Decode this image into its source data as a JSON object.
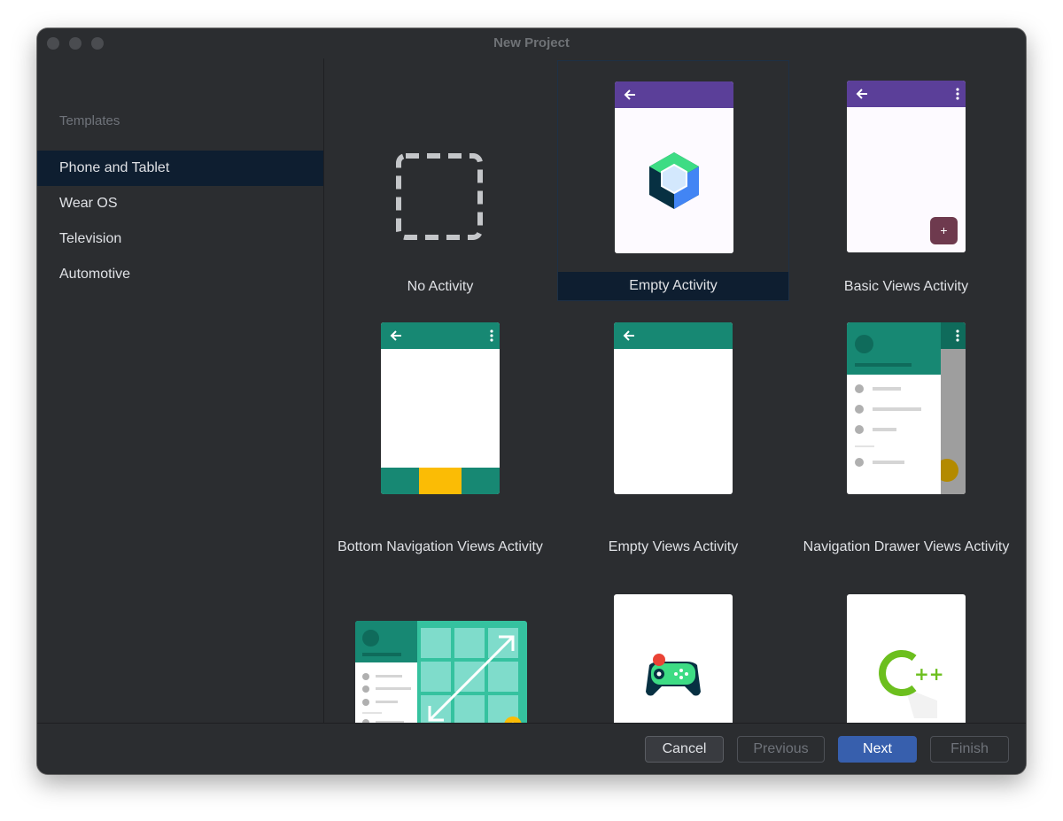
{
  "window": {
    "title": "New Project"
  },
  "sidebar": {
    "header": "Templates",
    "items": [
      {
        "label": "Phone and Tablet",
        "selected": true
      },
      {
        "label": "Wear OS",
        "selected": false
      },
      {
        "label": "Television",
        "selected": false
      },
      {
        "label": "Automotive",
        "selected": false
      }
    ]
  },
  "templates": [
    {
      "label": "No Activity",
      "selected": false
    },
    {
      "label": "Empty Activity",
      "selected": true
    },
    {
      "label": "Basic Views Activity",
      "selected": false
    },
    {
      "label": "Bottom Navigation Views Activity",
      "selected": false
    },
    {
      "label": "Empty Views Activity",
      "selected": false
    },
    {
      "label": "Navigation Drawer Views Activity",
      "selected": false
    },
    {
      "label": "",
      "selected": false
    },
    {
      "label": "",
      "selected": false
    },
    {
      "label": "",
      "selected": false
    }
  ],
  "preview_text": {
    "fab_plus": "+",
    "cpp_plus": "++"
  },
  "buttons": {
    "cancel": "Cancel",
    "previous": "Previous",
    "next": "Next",
    "finish": "Finish"
  },
  "colors": {
    "window_bg": "#2b2d30",
    "selection": "#0e1e30",
    "accent_button": "#375fad",
    "compose_appbar": "#5b3f99",
    "views_appbar": "#178873",
    "fab_compose": "#6e3a4e",
    "nav_highlight": "#fbbc05",
    "compose_logo": "#3ddc84",
    "cpp_logo": "#6cbf1e"
  }
}
